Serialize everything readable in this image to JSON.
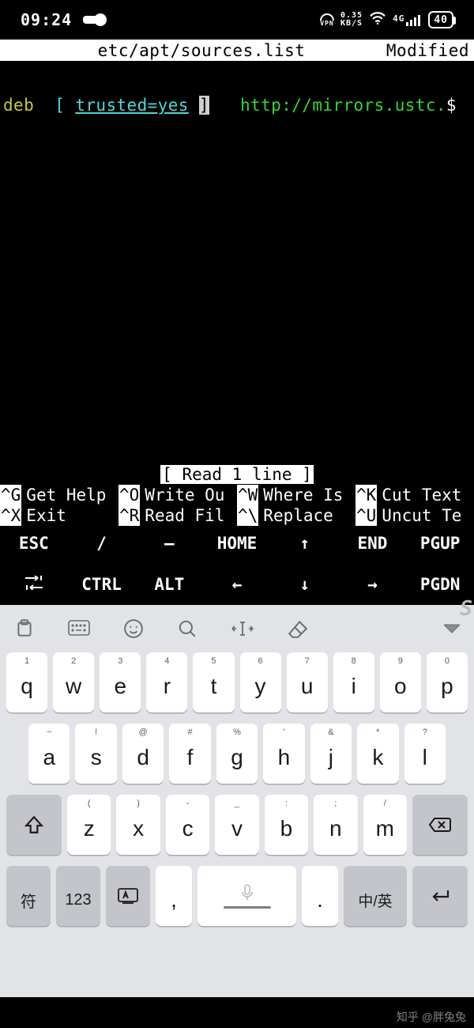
{
  "status": {
    "time": "09:24",
    "vpn_label": "VPN",
    "kbps_value": "0.35",
    "kbps_unit": "KB/S",
    "net_gen": "4G",
    "battery_pct": "40"
  },
  "nano": {
    "header": {
      "left": "",
      "file": "etc/apt/sources.list",
      "status": "Modified"
    },
    "line1": {
      "deb": "deb",
      "sp1": "  ",
      "lbr": "[ ",
      "trusted": "trusted=yes",
      "sp2": " ",
      "rbr": "]",
      "sp3": "   ",
      "url": "http://mirrors.ustc.",
      "tail": "$"
    },
    "message": "[ Read 1 line ]",
    "shortcuts_row1": [
      {
        "key": "^G",
        "desc": "Get Help"
      },
      {
        "key": "^O",
        "desc": "Write Ou"
      },
      {
        "key": "^W",
        "desc": "Where Is"
      },
      {
        "key": "^K",
        "desc": "Cut Text"
      }
    ],
    "shortcuts_row2": [
      {
        "key": "^X",
        "desc": "Exit"
      },
      {
        "key": "^R",
        "desc": "Read Fil"
      },
      {
        "key": "^\\",
        "desc": "Replace"
      },
      {
        "key": "^U",
        "desc": "Uncut Te"
      }
    ]
  },
  "extra_keys": {
    "row1": [
      "ESC",
      "/",
      "—",
      "HOME",
      "↑",
      "END",
      "PGUP"
    ],
    "row2": [
      "⇆",
      "CTRL",
      "ALT",
      "←",
      "↓",
      "→",
      "PGDN"
    ]
  },
  "keyboard": {
    "row1": [
      {
        "sup": "1",
        "main": "q"
      },
      {
        "sup": "2",
        "main": "w"
      },
      {
        "sup": "3",
        "main": "e"
      },
      {
        "sup": "4",
        "main": "r"
      },
      {
        "sup": "5",
        "main": "t"
      },
      {
        "sup": "6",
        "main": "y"
      },
      {
        "sup": "7",
        "main": "u"
      },
      {
        "sup": "8",
        "main": "i"
      },
      {
        "sup": "9",
        "main": "o"
      },
      {
        "sup": "0",
        "main": "p"
      }
    ],
    "row2": [
      {
        "sup": "~",
        "main": "a"
      },
      {
        "sup": "!",
        "main": "s"
      },
      {
        "sup": "@",
        "main": "d"
      },
      {
        "sup": "#",
        "main": "f"
      },
      {
        "sup": "%",
        "main": "g"
      },
      {
        "sup": "'",
        "main": "h"
      },
      {
        "sup": "&",
        "main": "j"
      },
      {
        "sup": "*",
        "main": "k"
      },
      {
        "sup": "?",
        "main": "l"
      }
    ],
    "row3": [
      {
        "sup": "(",
        "main": "z"
      },
      {
        "sup": ")",
        "main": "x"
      },
      {
        "sup": "-",
        "main": "c"
      },
      {
        "sup": "_",
        "main": "v"
      },
      {
        "sup": ":",
        "main": "b"
      },
      {
        "sup": ";",
        "main": "n"
      },
      {
        "sup": "/",
        "main": "m"
      }
    ],
    "row4": {
      "sym": "符",
      "num": "123",
      "lang": "",
      "comma": ",",
      "period": ".",
      "cn_en": "中/英"
    }
  },
  "watermark": "知乎 @胖兔兔"
}
